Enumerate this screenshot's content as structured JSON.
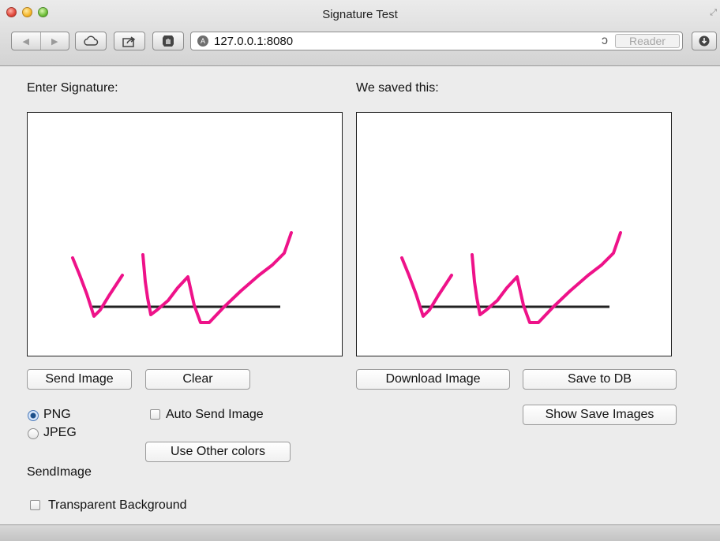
{
  "window": {
    "title": "Signature Test"
  },
  "toolbar": {
    "back_icon": "back-arrow-icon",
    "forward_icon": "forward-arrow-icon",
    "url": "127.0.0.1:8080",
    "reader_label": "Reader"
  },
  "page": {
    "enter_label": "Enter Signature:",
    "saved_label": "We saved this:",
    "send_button": "Send Image",
    "clear_button": "Clear",
    "download_button": "Download Image",
    "save_db_button": "Save to DB",
    "show_saved_button": "Show Save Images",
    "format_options": [
      {
        "label": "PNG",
        "checked": true
      },
      {
        "label": "JPEG",
        "checked": false
      }
    ],
    "auto_send_label": "Auto Send Image",
    "other_colors_button": "Use Other colors",
    "send_image_text": "SendImage",
    "transparent_label": "Transparent Background"
  },
  "colors": {
    "stroke": "#ee1289",
    "baseline": "#222222"
  }
}
